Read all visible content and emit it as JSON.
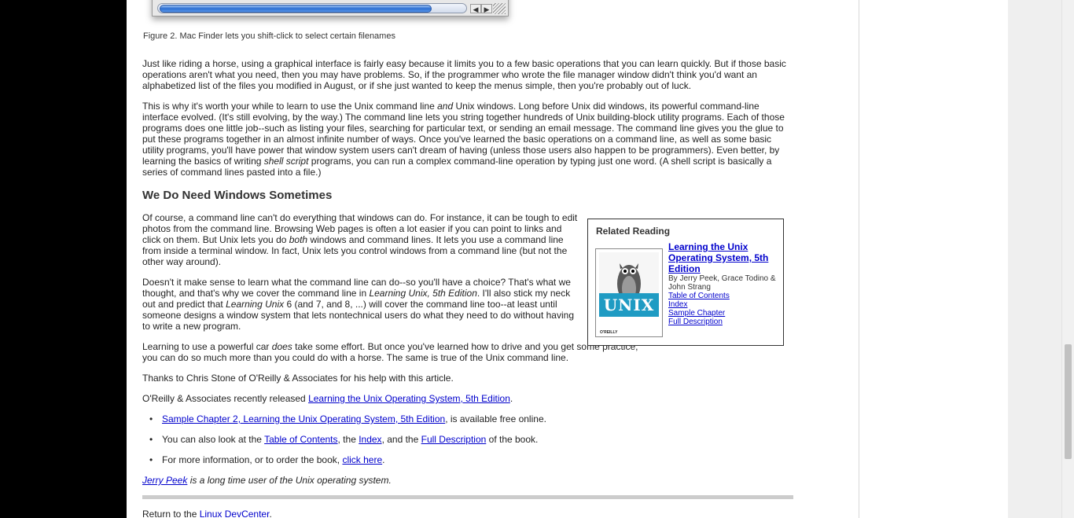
{
  "figure": {
    "caption": "Figure 2. Mac Finder lets you shift-click to select certain filenames",
    "scroll_left_icon": "left-arrow-icon",
    "scroll_right_icon": "right-arrow-icon"
  },
  "p1": "Just like riding a horse, using a graphical interface is fairly easy because it limits you to a few basic operations that you can learn quickly. But if those basic operations aren't what you need, then you may have problems. So, if the programmer who wrote the file manager window didn't think you'd want an alphabetized list of the files you modified in August, or if she just wanted to keep the menus simple, then you're probably out of luck.",
  "p2": {
    "a": "This is why it's worth your while to learn to use the Unix command line ",
    "em1": "and",
    "b": " Unix windows. Long before Unix did windows, its powerful command-line interface evolved. (It's still evolving, by the way.) The command line lets you string together hundreds of Unix building-block utility programs. Each of those programs does one little job--such as listing your files, searching for particular text, or sending an email message. The command line gives you the glue to put these programs together in an almost infinite number of ways. Once you've learned the basic operations on a command line, as well as some basic utility programs, you'll have power that window system users can't dream of having (unless those users also happen to be programmers). Even better, by learning the basics of writing ",
    "em2": "shell script",
    "c": " programs, you can run a complex command-line operation by typing just one word. (A shell script is basically a series of command lines pasted into a file.)"
  },
  "heading": "We Do Need Windows Sometimes",
  "p3": {
    "a": "Of course, a command line can't do everything that windows can do. For instance, it can be tough to edit photos from the command line. Browsing Web pages is often a lot easier if you can point to links and click on them. But Unix lets you do ",
    "em": "both",
    "b": " windows and command lines. It lets you use a command line from inside a terminal window. In fact, Unix lets you control windows from a command line (but not the other way around)."
  },
  "p4": {
    "a": "Doesn't it make sense to learn what the command line can do--so you'll have a choice? That's what we thought, and that's why we cover the command line in ",
    "em1": "Learning Unix, 5th Edition",
    "b": ". I'll also stick my neck out and predict that ",
    "em2": "Learning Unix",
    "c": " 6 (and 7, and 8, ...) will cover the command line too--at least until someone designs a window system that lets nontechnical users do what they need to do without having to write a new program."
  },
  "p5": {
    "a": "Learning to use a powerful car ",
    "em": "does",
    "b": " take some effort. But once you've learned how to drive and you get some practice, you can do so much more than you could do with a horse. The same is true of the Unix command line."
  },
  "p6": "Thanks to Chris Stone of O'Reilly & Associates for his help with this article.",
  "p7": {
    "a": "O'Reilly & Associates recently released ",
    "link": "Learning the Unix Operating System, 5th Edition",
    "b": "."
  },
  "bullets": {
    "b1_link": "Sample Chapter 2, Learning the Unix Operating System, 5th Edition",
    "b1_text": ", is available free online.",
    "b2_a": "You can also look at the ",
    "b2_link1": "Table of Contents",
    "b2_b": ", the ",
    "b2_link2": "Index",
    "b2_c": ", and the ",
    "b2_link3": "Full Description",
    "b2_d": " of the book.",
    "b3_a": "For more information, or to order the book, ",
    "b3_link": "click here",
    "b3_b": "."
  },
  "author": {
    "link": "Jerry Peek",
    "text": " is a long time user of the Unix operating system."
  },
  "footer": {
    "a": "Return to the ",
    "link": "Linux DevCenter",
    "b": "."
  },
  "related": {
    "title": "Related Reading",
    "book_title": "Learning the Unix Operating System, 5th Edition",
    "authors": "By Jerry Peek, Grace Todino & John Strang",
    "links": [
      "Table of Contents",
      "Index",
      "Sample Chapter",
      "Full Description"
    ],
    "cover_word": "UNIX",
    "cover_publisher": "O'REILLY",
    "cover_accent": "#1f9bc3"
  },
  "colors": {
    "link": "#0000cc",
    "text": "#222222",
    "left_bar": "#000000"
  }
}
